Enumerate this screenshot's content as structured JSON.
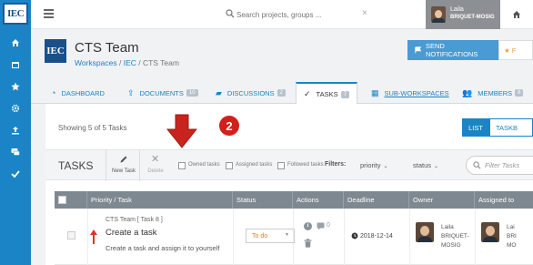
{
  "rail": {
    "logo_text": "IEC",
    "icons": [
      "home-icon",
      "calendar-icon",
      "star-icon",
      "gear-icon",
      "upload-icon",
      "chat-icon",
      "check-icon"
    ]
  },
  "topbar": {
    "search_placeholder": "Search projects, groups ...",
    "clear_symbol": "×",
    "user_first": "Laila",
    "user_last": "BRIQUET-MOSIG"
  },
  "header": {
    "logo_text": "IEC",
    "title": "CTS Team",
    "breadcrumb": {
      "workspaces": "Workspaces",
      "sep1": " / ",
      "iec": "IEC",
      "sep2": " / ",
      "current": "CTS Team"
    },
    "notify_label": "SEND NOTIFICATIONS",
    "fav_label": "F"
  },
  "tabs": [
    {
      "label": "DASHBOARD",
      "count": ""
    },
    {
      "label": "DOCUMENTS",
      "count": "10"
    },
    {
      "label": "DISCUSSIONS",
      "count": "2"
    },
    {
      "label": "TASKS",
      "count": "7"
    },
    {
      "label": "SUB-WORKSPACES",
      "count": ""
    },
    {
      "label": "MEMBERS",
      "count": "8"
    }
  ],
  "panel": {
    "showing": "Showing 5 of 5 Tasks",
    "list_label": "LIST",
    "taskboard_label": "TASKB",
    "step_number": "2"
  },
  "toolbar": {
    "title": "TASKS",
    "new_task": "New Task",
    "delete": "Delete",
    "owned": "Owned tasks",
    "assigned": "Assigned tasks",
    "followed": "Followed tasks",
    "filters": "Filters:",
    "priority": "priority",
    "status": "status",
    "filter_placeholder": "Filter Tasks"
  },
  "table": {
    "headers": [
      "Priority / Task",
      "Status",
      "Actions",
      "Deadline",
      "Owner",
      "Assigned to"
    ],
    "row": {
      "context": "CTS Team [ Task 8 ]",
      "name": "Create a task",
      "description": "Create a task and assign it to yourself",
      "status": "To do",
      "comments": "0",
      "deadline": "2018-12-14",
      "owner": [
        "Laila",
        "BRIQUET-",
        "MOSIG"
      ],
      "assignee": [
        "Lai",
        "BRI",
        "MO"
      ]
    }
  },
  "colors": {
    "rail": "#1a84c6",
    "accent": "#1a84c6",
    "annotation_red": "#d0201c",
    "status_orange": "#e07a2b"
  }
}
